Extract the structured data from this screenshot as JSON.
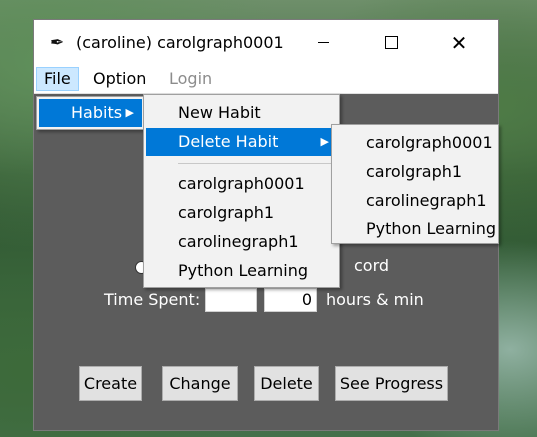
{
  "window": {
    "title": "(caroline) carolgraph0001",
    "app_icon": "tk-feather-icon",
    "minimize_icon": "minimize-icon",
    "maximize_icon": "maximize-icon",
    "close_icon": "close-icon"
  },
  "menubar": {
    "file": "File",
    "option": "Option",
    "login": "Login"
  },
  "file_menu": {
    "habits": "Habits",
    "arrow": "▶"
  },
  "habits_menu": {
    "new_habit": "New Habit",
    "delete_habit": "Delete Habit",
    "arrow": "▶",
    "habits": [
      "carolgraph0001",
      "carolgraph1",
      "carolinegraph1",
      "Python Learning"
    ]
  },
  "delete_menu": {
    "habits": [
      "carolgraph0001",
      "carolgraph1",
      "carolinegraph1",
      "Python Learning"
    ]
  },
  "form": {
    "record_fragment": "cord",
    "time_spent_label": "Time Spent:",
    "hours_value": "",
    "minutes_value": "0",
    "unit_label": "hours & min"
  },
  "buttons": {
    "create": "Create",
    "change": "Change",
    "delete": "Delete",
    "see_progress": "See Progress"
  },
  "colors": {
    "highlight": "#0078d7",
    "content_bg": "#5c5c5c",
    "menu_bg": "#f2f2f2"
  }
}
